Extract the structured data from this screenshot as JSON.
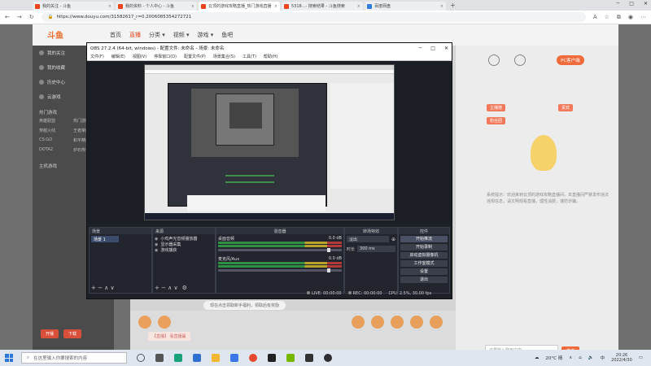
{
  "browser": {
    "tabs": [
      {
        "title": "我的关注 - 斗鱼",
        "active": false
      },
      {
        "title": "我的资料 - 个人中心 - 斗鱼",
        "active": false
      },
      {
        "title": "云顶的游戏攻略直播_热门游戏直播",
        "active": true
      },
      {
        "title": "5318...- 搜索结果 - 斗鱼搜索",
        "active": false
      },
      {
        "title": "百度网盘",
        "active": false
      }
    ],
    "url": "https://www.douyu.com/31582617_r=0.2006085354272721"
  },
  "douyu": {
    "logo": "斗鱼",
    "nav": [
      "首页",
      "直播",
      "分类 ▾",
      "视频 ▾",
      "游戏 ▾",
      "鱼吧"
    ],
    "left_nav": [
      "我的关注",
      "我的收藏",
      "历史中心",
      "云游戏"
    ],
    "left_section_title": "热门游戏",
    "left_grid": [
      "英雄联盟",
      "热门游戏",
      "穿越火线",
      "王者荣耀",
      "CS:GO",
      "和平精英",
      "DOTA2",
      "炉石传说"
    ],
    "left_section_title_2": "主机游戏",
    "left_btns": [
      "开播",
      "下载"
    ],
    "hot_badge": "PC客户端",
    "chips": [
      "主播榜",
      "贵宾",
      "粉丝团"
    ],
    "chat_text": "系统提示：欢迎来到云顶的游戏攻略直播间，本直播间严禁发布违法违规信息，请文明观看直播，理性消费，谨防诈骗。",
    "chat_placeholder": "这里输入聊天内容...",
    "send_label": "发送",
    "bottom_info": "【直播】 看直播赢",
    "notice_text": "现在点击领取新手福利，领取后有奖励"
  },
  "obs": {
    "title": "OBS 27.2.4 (64-bit, windows) - 配置文件: 未命名 - 场景: 未命名",
    "menu": [
      "文件(F)",
      "编辑(E)",
      "视图(V)",
      "停靠窗口(D)",
      "配置文件(P)",
      "场景集合(S)",
      "工具(T)",
      "帮助(H)"
    ],
    "docks": {
      "scenes": "场景",
      "sources": "来源",
      "mixer": "混音器",
      "transitions": "转场特效",
      "controls": "控件"
    },
    "scene_list": [
      "场景 1"
    ],
    "source_list": [
      "小鸡声光音频播放器",
      "显示器采集",
      "游戏捕获"
    ],
    "mixer": [
      {
        "name": "桌面音频",
        "db": "0.0 dB"
      },
      {
        "name": "麦克风/Aux",
        "db": "0.0 dB"
      }
    ],
    "transition": {
      "type": "淡出",
      "duration_label": "时长",
      "duration": "300 ms"
    },
    "controls": [
      "开始推流",
      "开始录制",
      "启动虚拟摄像机",
      "工作室模式",
      "设置",
      "退出"
    ],
    "status": {
      "live": "LIVE: 00:00:00",
      "rec": "REC: 00:00:00",
      "cpu": "CPU: 2.5%, 30.00 fps"
    },
    "dock_footer": "+ − ∧ ∨"
  },
  "taskbar": {
    "search_placeholder": "在这里输入你要搜索的内容",
    "temperature": "20°C 晴",
    "time": "20:26",
    "date": "2022/4/30"
  }
}
